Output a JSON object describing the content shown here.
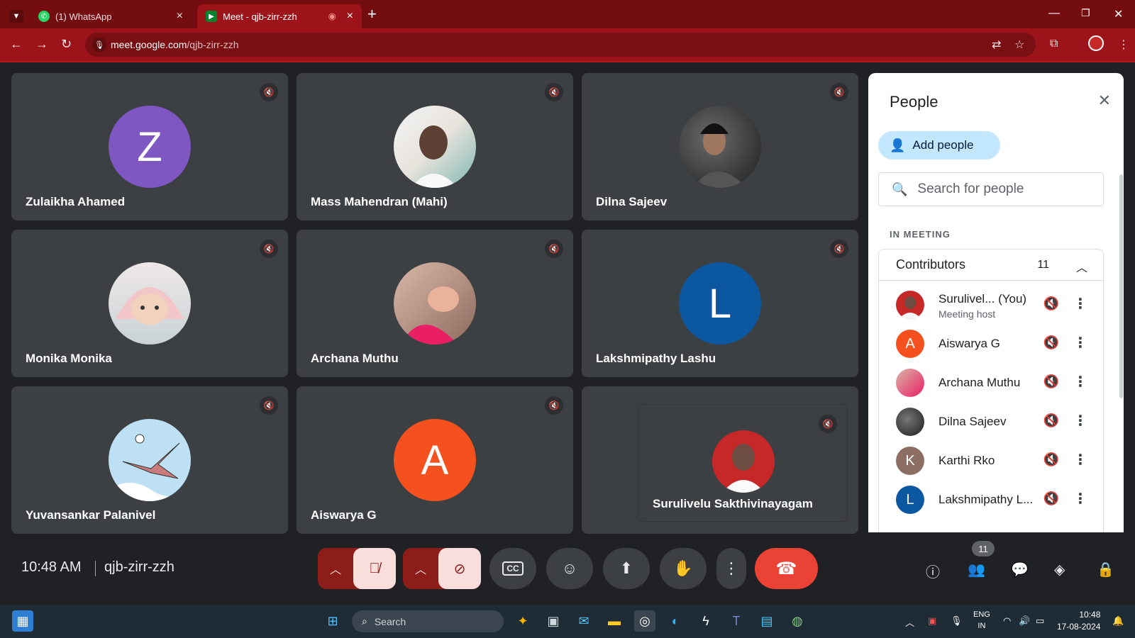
{
  "browser": {
    "tabs": [
      {
        "title": "(1) WhatsApp",
        "active": false
      },
      {
        "title": "Meet - qjb-zirr-zzh",
        "active": true
      }
    ],
    "url_host": "meet.google.com",
    "url_path": "/qjb-zirr-zzh"
  },
  "tiles": [
    {
      "name": "Zulaikha Ahamed",
      "initial": "Z",
      "color": "#7e57c2"
    },
    {
      "name": "Mass Mahendran (Mahi)",
      "initial": "",
      "color": "#a8b4ba"
    },
    {
      "name": "Dilna Sajeev",
      "initial": "",
      "color": "#3a3a3a"
    },
    {
      "name": "Monika Monika",
      "initial": "",
      "color": "#d9c2c2"
    },
    {
      "name": "Archana Muthu",
      "initial": "",
      "color": "#c99a8a"
    },
    {
      "name": "Lakshmipathy Lashu",
      "initial": "L",
      "color": "#0b57a0"
    },
    {
      "name": "Yuvansankar Palanivel",
      "initial": "",
      "color": "#bde0f5"
    },
    {
      "name": "Aiswarya G",
      "initial": "A",
      "color": "#f4511e"
    },
    {
      "name": "Surulivelu Sakthivinayagam",
      "initial": "",
      "color": "#c62828"
    }
  ],
  "people_panel": {
    "title": "People",
    "add_people": "Add people",
    "search_placeholder": "Search for people",
    "section": "IN MEETING",
    "group_label": "Contributors",
    "group_count": "11",
    "people": [
      {
        "name": "Surulivel...  (You)",
        "sub": "Meeting host",
        "initial": "",
        "color": "#c62828"
      },
      {
        "name": "Aiswarya G",
        "sub": "",
        "initial": "A",
        "color": "#f4511e"
      },
      {
        "name": "Archana Muthu",
        "sub": "",
        "initial": "",
        "color": "#c99a8a"
      },
      {
        "name": "Dilna Sajeev",
        "sub": "",
        "initial": "",
        "color": "#3a3a3a"
      },
      {
        "name": "Karthi Rko",
        "sub": "",
        "initial": "K",
        "color": "#8d6e63"
      },
      {
        "name": "Lakshmipathy L...",
        "sub": "",
        "initial": "L",
        "color": "#0b57a0"
      }
    ]
  },
  "meeting": {
    "time": "10:48 AM",
    "code": "qjb-zirr-zzh",
    "people_badge": "11"
  },
  "taskbar": {
    "search_placeholder": "Search",
    "lang_line1": "ENG",
    "lang_line2": "IN",
    "clock_time": "10:48",
    "clock_date": "17-08-2024"
  },
  "colors": {
    "tab_bar": "#740d10",
    "toolbar": "#9c1419",
    "tile_bg": "#3c4043",
    "end_call": "#ea4335",
    "add_people_bg": "#c2e7ff"
  }
}
